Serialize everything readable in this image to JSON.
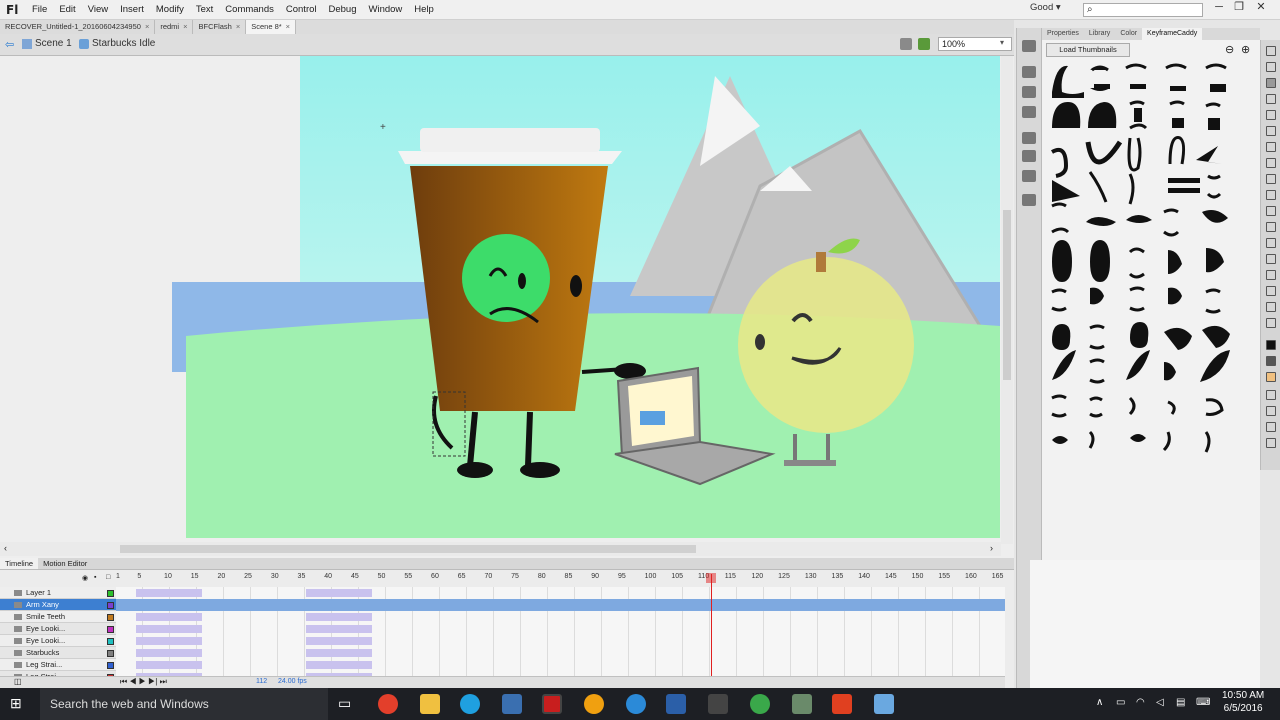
{
  "app": {
    "logo": "Fl",
    "workspace": "Good"
  },
  "menu": [
    "File",
    "Edit",
    "View",
    "Insert",
    "Modify",
    "Text",
    "Commands",
    "Control",
    "Debug",
    "Window",
    "Help"
  ],
  "doc_tabs": [
    {
      "label": "RECOVER_Untitled-1_20160604234950",
      "active": false
    },
    {
      "label": "redmi",
      "active": false
    },
    {
      "label": "BFCFlash",
      "active": false
    },
    {
      "label": "Scene 8*",
      "active": true
    }
  ],
  "edit_bar": {
    "scene": "Scene 1",
    "symbol": "Starbucks Idle",
    "zoom": "100%"
  },
  "panel": {
    "tabs": [
      "Properties",
      "Library",
      "Color",
      "KeyframeCaddy"
    ],
    "active_tab": "KeyframeCaddy",
    "load_button": "Load Thumbnails"
  },
  "timeline": {
    "tabs": [
      "Timeline",
      "Motion Editor"
    ],
    "ruler": [
      "1",
      "5",
      "10",
      "15",
      "20",
      "25",
      "30",
      "35",
      "40",
      "45",
      "50",
      "55",
      "60",
      "65",
      "70",
      "75",
      "80",
      "85",
      "90",
      "95",
      "100",
      "105",
      "110",
      "115",
      "120",
      "125",
      "130",
      "135",
      "140",
      "145",
      "150",
      "155",
      "160",
      "165"
    ],
    "layers": [
      {
        "name": "Layer 1",
        "color": "#2dbf2d",
        "selected": false
      },
      {
        "name": "Arm Xany",
        "color": "#7a3fd0",
        "selected": true
      },
      {
        "name": "Smile Teeth",
        "color": "#c07a20",
        "selected": false
      },
      {
        "name": "Eye Looki...",
        "color": "#c030c0",
        "selected": false
      },
      {
        "name": "Eye Looki...",
        "color": "#20c0c0",
        "selected": false
      },
      {
        "name": "Starbucks",
        "color": "#808080",
        "selected": false
      },
      {
        "name": "Leg Strai...",
        "color": "#3060d0",
        "selected": false
      },
      {
        "name": "Leg Strai...",
        "color": "#d03030",
        "selected": false
      }
    ],
    "fps": "24.00 fps",
    "frame": "112"
  },
  "taskbar": {
    "search_placeholder": "Search the web and Windows",
    "time": "10:50 AM",
    "date": "6/5/2016"
  }
}
